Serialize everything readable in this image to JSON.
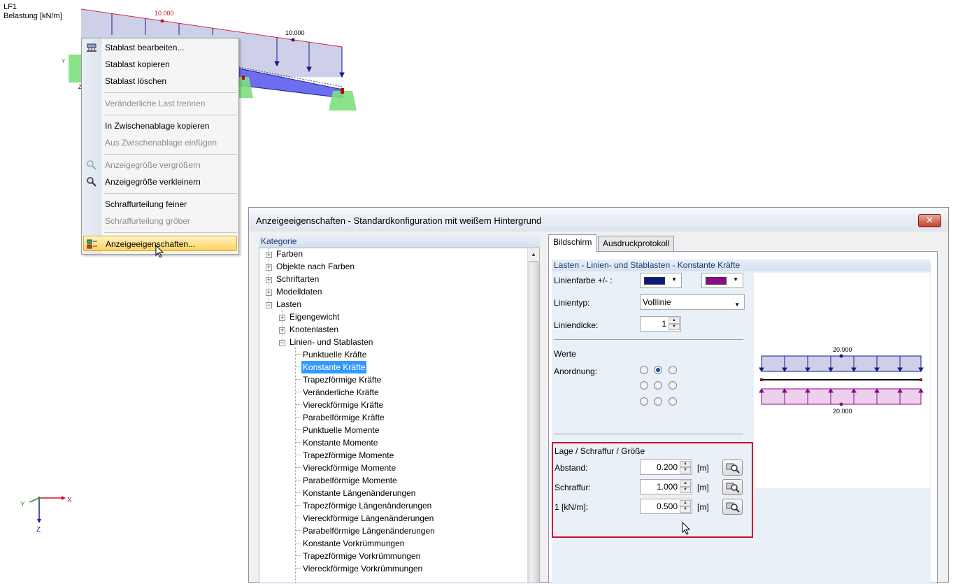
{
  "viewport": {
    "loadcase": "LF1",
    "subtitle": "Belastung [kN/m]",
    "load_label_1": "10.000",
    "load_label_2": "10.000",
    "axis_x": "X",
    "axis_y": "Y",
    "axis_z": "Z",
    "axis_y_small": "Y",
    "axis_z_small": "Z"
  },
  "context_menu": {
    "items": [
      {
        "label": "Stablast bearbeiten...",
        "enabled": true,
        "icon": "edit-load-icon"
      },
      {
        "label": "Stablast kopieren",
        "enabled": true
      },
      {
        "label": "Stablast löschen",
        "enabled": true
      },
      {
        "label": "Veränderliche Last trennen",
        "enabled": false
      },
      {
        "label": "In Zwischenablage kopieren",
        "enabled": true
      },
      {
        "label": "Aus Zwischenablage einfügen",
        "enabled": false
      },
      {
        "label": "Anzeigegröße vergrößern",
        "enabled": false,
        "icon": "zoom-in-icon"
      },
      {
        "label": "Anzeigegröße verkleinern",
        "enabled": true,
        "icon": "zoom-out-icon"
      },
      {
        "label": "Schraffurteilung feiner",
        "enabled": true
      },
      {
        "label": "Schraffurteilung gröber",
        "enabled": false
      },
      {
        "label": "Anzeigeeigenschaften...",
        "enabled": true,
        "highlighted": true,
        "icon": "display-properties-icon"
      }
    ]
  },
  "dialog": {
    "title": "Anzeigeeigenschaften - Standardkonfiguration mit weißem Hintergrund",
    "close_glyph": "✕",
    "category_header": "Kategorie",
    "tree": [
      {
        "label": "Farben",
        "level": 0,
        "expander": "+"
      },
      {
        "label": "Objekte nach Farben",
        "level": 0,
        "expander": "+"
      },
      {
        "label": "Schriftarten",
        "level": 0,
        "expander": "+"
      },
      {
        "label": "Modelldaten",
        "level": 0,
        "expander": "+"
      },
      {
        "label": "Lasten",
        "level": 0,
        "expander": "−"
      },
      {
        "label": "Eigengewicht",
        "level": 1,
        "expander": "+"
      },
      {
        "label": "Knotenlasten",
        "level": 1,
        "expander": "+"
      },
      {
        "label": "Linien- und Stablasten",
        "level": 1,
        "expander": "−"
      },
      {
        "label": "Punktuelle Kräfte",
        "level": 2
      },
      {
        "label": "Konstante Kräfte",
        "level": 2,
        "selected": true
      },
      {
        "label": "Trapezförmige Kräfte",
        "level": 2
      },
      {
        "label": "Veränderliche Kräfte",
        "level": 2
      },
      {
        "label": "Viereckförmige Kräfte",
        "level": 2
      },
      {
        "label": "Parabelförmige Kräfte",
        "level": 2
      },
      {
        "label": "Punktuelle Momente",
        "level": 2
      },
      {
        "label": "Konstante Momente",
        "level": 2
      },
      {
        "label": "Trapezförmige Momente",
        "level": 2
      },
      {
        "label": "Viereckförmige Momente",
        "level": 2
      },
      {
        "label": "Parabelförmige Momente",
        "level": 2
      },
      {
        "label": "Konstante Längenänderungen",
        "level": 2
      },
      {
        "label": "Trapezförmige Längenänderungen",
        "level": 2
      },
      {
        "label": "Viereckförmige Längenänderungen",
        "level": 2
      },
      {
        "label": "Parabelförmige Längenänderungen",
        "level": 2
      },
      {
        "label": "Konstante Vorkrümmungen",
        "level": 2
      },
      {
        "label": "Trapezförmige Vorkrümmungen",
        "level": 2
      },
      {
        "label": "Viereckförmige Vorkrümmungen",
        "level": 2
      }
    ],
    "tabs": [
      {
        "label": "Bildschirm",
        "active": true
      },
      {
        "label": "Ausdruckprotokoll",
        "active": false
      }
    ],
    "section_title": "Lasten - Linien- und Stablasten - Konstante Kräfte",
    "line_color_label": "Linienfarbe +/- :",
    "line_color_pos": "#0a1a7a",
    "line_color_neg": "#8a0a8a",
    "line_type_label": "Linientyp:",
    "line_type_value": "Volllinie",
    "line_width_label": "Liniendicke:",
    "line_width_value": "1",
    "werte_label": "Werte",
    "anordnung_label": "Anordnung:",
    "anordnung_selected": "top-center",
    "lage_label": "Lage / Schraffur / Größe",
    "abstand_label": "Abstand:",
    "abstand_value": "0.200",
    "abstand_unit": "[m]",
    "schraffur_label": "Schraffur:",
    "schraffur_value": "1.000",
    "schraffur_unit": "[m]",
    "scale_label": "1  [kN/m]:",
    "scale_value": "0.500",
    "scale_unit": "[m]",
    "preview_top_value": "20.000",
    "preview_bottom_value": "20.000"
  },
  "colors": {
    "load_fill": "#cdd0e8",
    "highlight": "#ffd35e",
    "selection": "#3399ff",
    "red_frame": "#c8102e"
  }
}
